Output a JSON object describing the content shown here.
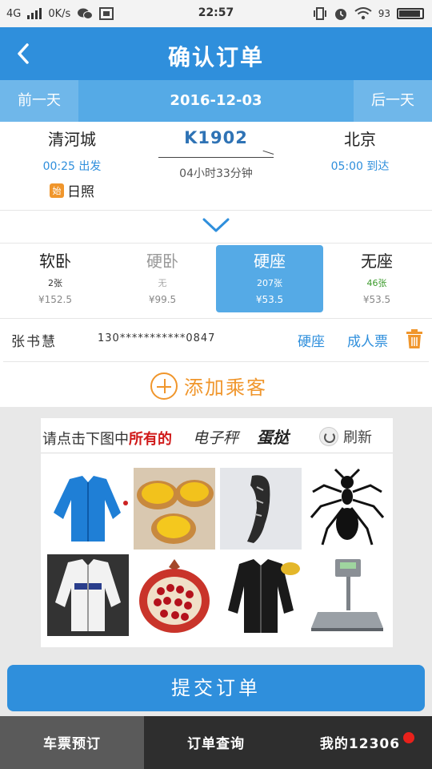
{
  "status_bar": {
    "network": "4G",
    "speed": "0K/s",
    "time": "22:57",
    "battery": "93"
  },
  "header": {
    "title": "确认订单",
    "back_icon": "chevron-left-icon"
  },
  "date_bar": {
    "prev_label": "前一天",
    "date": "2016-12-03",
    "next_label": "后一天"
  },
  "train": {
    "from_city": "清河城",
    "depart_time": "00:25 出发",
    "start_badge": "始",
    "start_station": "日照",
    "number": "K1902",
    "duration": "04小时33分钟",
    "to_city": "北京",
    "arrive_time": "05:00 到达"
  },
  "seats": [
    {
      "name": "软卧",
      "count": "2张",
      "price": "¥152.5"
    },
    {
      "name": "硬卧",
      "count": "无",
      "price": "¥99.5"
    },
    {
      "name": "硬座",
      "count": "207张",
      "price": "¥53.5"
    },
    {
      "name": "无座",
      "count": "46张",
      "price": "¥53.5"
    }
  ],
  "passenger": {
    "name": "张书慧",
    "phone": "130***********0847",
    "seat_type": "硬座",
    "ticket_type": "成人票"
  },
  "add_passenger": {
    "label": "添加乘客"
  },
  "captcha": {
    "prompt_prefix": "请点击下图中",
    "prompt_bold": "所有的",
    "word1": "电子秤",
    "word2": "蛋挞",
    "refresh_label": "刷新"
  },
  "submit": {
    "label": "提交订单"
  },
  "bottom_nav": {
    "tabs": [
      "车票预订",
      "订单查询",
      "我的12306"
    ]
  },
  "colors": {
    "primary": "#2f8fdc",
    "accent": "#f0962c",
    "selected_seat": "#55aae6",
    "nav_bg": "#2e2e2e",
    "badge_red": "#e8211b"
  }
}
